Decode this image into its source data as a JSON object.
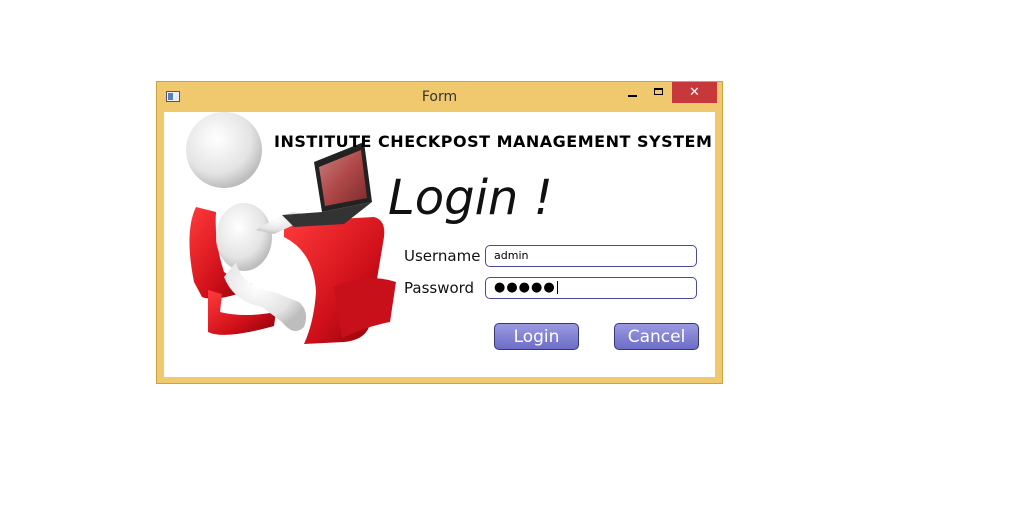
{
  "window": {
    "title": "Form",
    "frame_color": "#f0c86e",
    "close_button_color": "#c7383a",
    "close_glyph": "✕"
  },
  "header": {
    "system_title": "INSTITUTE CHECKPOST MANAGEMENT SYSTEM",
    "login_heading": "Login !"
  },
  "form": {
    "username_label": "Username",
    "username_value": "admin",
    "password_label": "Password",
    "password_masked": "●●●●●"
  },
  "buttons": {
    "login_label": "Login",
    "cancel_label": "Cancel",
    "button_color": "#7d7dd6"
  },
  "icons": {
    "app": "app-icon",
    "minimize": "minimize-icon",
    "maximize": "maximize-icon",
    "close": "close-icon"
  }
}
